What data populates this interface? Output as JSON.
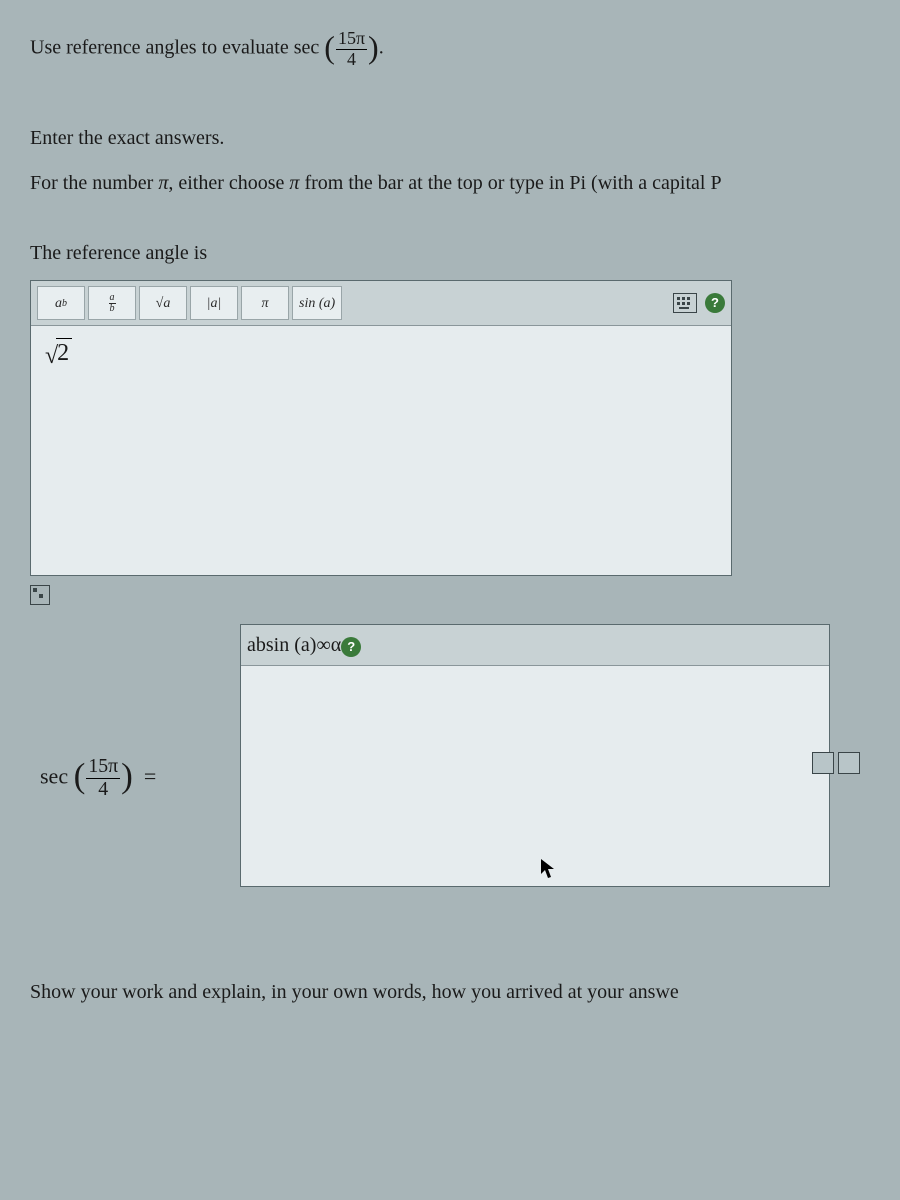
{
  "question": {
    "prefix": "Use reference angles to evaluate sec",
    "arg_num": "15π",
    "arg_den": "4",
    "suffix": "."
  },
  "instructions_line1": "Enter the exact answers.",
  "instructions_line2_a": "For the number ",
  "instructions_line2_pi1": "π",
  "instructions_line2_b": ", either choose ",
  "instructions_line2_pi2": "π",
  "instructions_line2_c": " from the bar at the top or type in Pi (with a capital P",
  "prompt1": "The reference angle is",
  "editor1": {
    "tools": {
      "power": {
        "a": "a",
        "b": "b"
      },
      "frac": {
        "a": "a",
        "b": "b"
      },
      "sqrt": "√a",
      "abs": "|a|",
      "pi": "π",
      "sin": "sin (a)"
    },
    "input_radicand": "2",
    "help": "?"
  },
  "editor2": {
    "tools": {
      "power": {
        "a": "a",
        "b": "b"
      },
      "sin": "sin (a)",
      "inf": "∞",
      "alpha": "α"
    },
    "help": "?"
  },
  "lhs": {
    "func": "sec",
    "arg_num": "15π",
    "arg_den": "4",
    "eq": "="
  },
  "show_work": "Show your work and explain, in your own words, how you arrived at your answe"
}
